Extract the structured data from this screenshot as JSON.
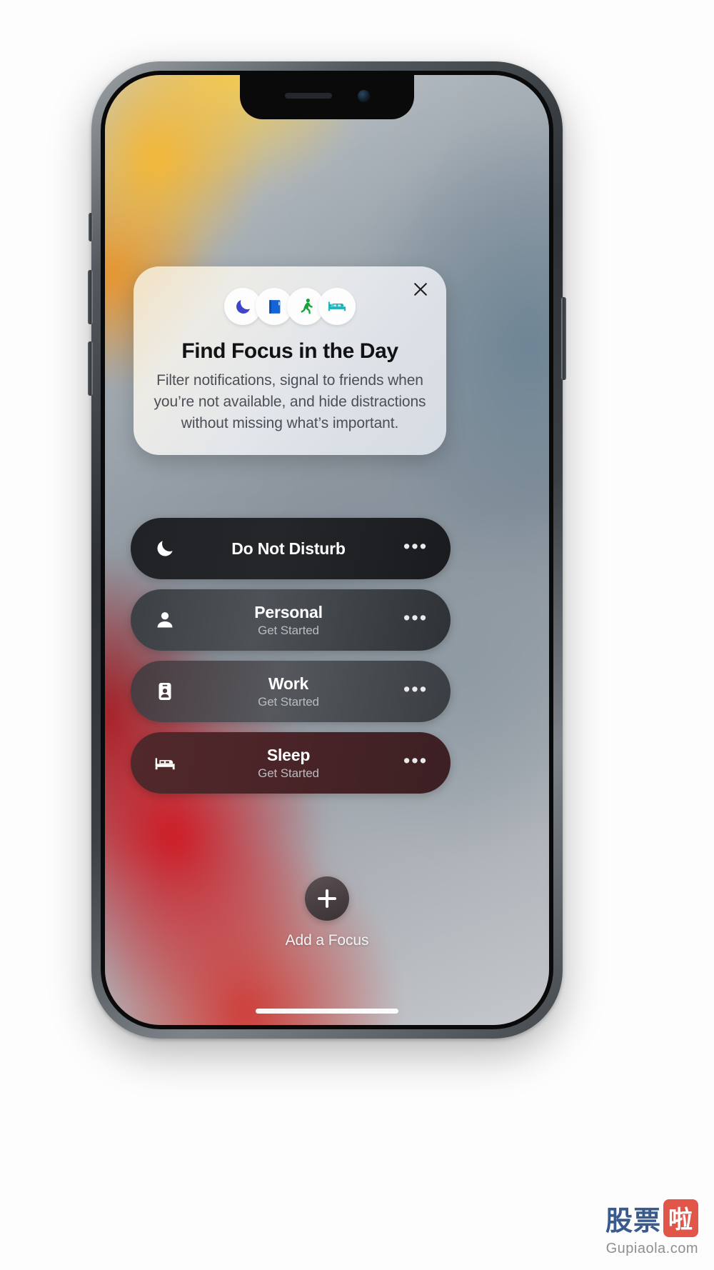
{
  "card": {
    "close_label": "✕",
    "title": "Find Focus in the Day",
    "body": "Filter notifications, signal to friends when you’re not available, and hide distractions without missing what’s important.",
    "icons": [
      {
        "name": "moon-icon",
        "color": "#3f45c9"
      },
      {
        "name": "book-icon",
        "color": "#1464d6"
      },
      {
        "name": "running-person-icon",
        "color": "#16a338"
      },
      {
        "name": "bed-icon",
        "color": "#19b2b8"
      }
    ]
  },
  "focus_list": [
    {
      "name": "Do Not Disturb",
      "subtitle": "",
      "icon": "moon-icon",
      "more_label": "•••"
    },
    {
      "name": "Personal",
      "subtitle": "Get Started",
      "icon": "person-icon",
      "more_label": "•••"
    },
    {
      "name": "Work",
      "subtitle": "Get Started",
      "icon": "id-badge-icon",
      "more_label": "•••"
    },
    {
      "name": "Sleep",
      "subtitle": "Get Started",
      "icon": "bed-icon",
      "more_label": "•••"
    }
  ],
  "add_focus": {
    "label": "Add a Focus",
    "icon": "plus-icon"
  },
  "watermark": {
    "text_cn": "股票",
    "text_cn_badge": "啦",
    "url": "Gupiaola.com"
  },
  "colors": {
    "row_dnd": "#202225",
    "row_personal": "#4d5257",
    "row_work": "#55585c",
    "row_sleep": "#4a2428",
    "title": "#111214",
    "body": "#4c4f55",
    "watermark_blue": "#3a5a8c",
    "watermark_red": "#e2564a"
  }
}
